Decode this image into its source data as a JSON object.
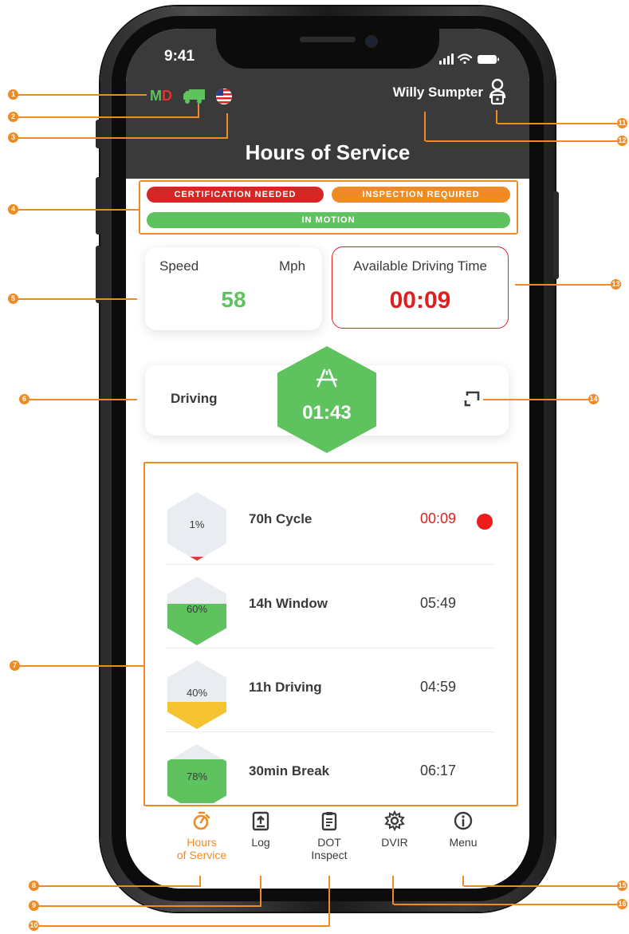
{
  "status_bar": {
    "time": "9:41"
  },
  "header": {
    "md_m": "M",
    "md_d": "D",
    "title": "Hours of Service",
    "user_name": "Willy Sumpter",
    "icons": [
      "truck-icon",
      "us-flag-icon",
      "user-lock-icon"
    ]
  },
  "alerts": {
    "certification": "CERTIFICATION NEEDED",
    "inspection": "INSPECTION REQUIRED",
    "motion": "IN MOTION"
  },
  "speed_card": {
    "label": "Speed",
    "unit": "Mph",
    "value": "58"
  },
  "available_card": {
    "label": "Available Driving Time",
    "value": "00:09"
  },
  "status_card": {
    "label": "Driving",
    "time": "01:43"
  },
  "timers": [
    {
      "label": "70h Cycle",
      "percent": "1%",
      "fill_percent": 1,
      "fill_color": "#e63a3a",
      "time": "00:09",
      "alert": true
    },
    {
      "label": "14h Window",
      "percent": "60%",
      "fill_percent": 60,
      "fill_color": "#5ec25e",
      "time": "05:49",
      "alert": false
    },
    {
      "label": "11h Driving",
      "percent": "40%",
      "fill_percent": 40,
      "fill_color": "#f6c330",
      "time": "04:59",
      "alert": false
    },
    {
      "label": "30min Break",
      "percent": "78%",
      "fill_percent": 78,
      "fill_color": "#5ec25e",
      "time": "06:17",
      "alert": false
    }
  ],
  "nav": {
    "hos_line1": "Hours",
    "hos_line2": "of Service",
    "log": "Log",
    "dot_line1": "DOT",
    "dot_line2": "Inspect",
    "dvir": "DVIR",
    "menu": "Menu"
  },
  "callouts": {
    "c1": "1",
    "c2": "2",
    "c3": "3",
    "c4": "4",
    "c5": "5",
    "c6": "6",
    "c7": "7",
    "c8": "8",
    "c9": "9",
    "c10": "10",
    "c11": "11",
    "c12": "12",
    "c13": "13",
    "c14": "14",
    "c15": "15",
    "c16": "16"
  },
  "colors": {
    "accent_orange": "#f08a24",
    "green": "#5ec25e",
    "red": "#e02020",
    "yellow": "#f6c330",
    "header_dark": "#3a3a3a"
  }
}
